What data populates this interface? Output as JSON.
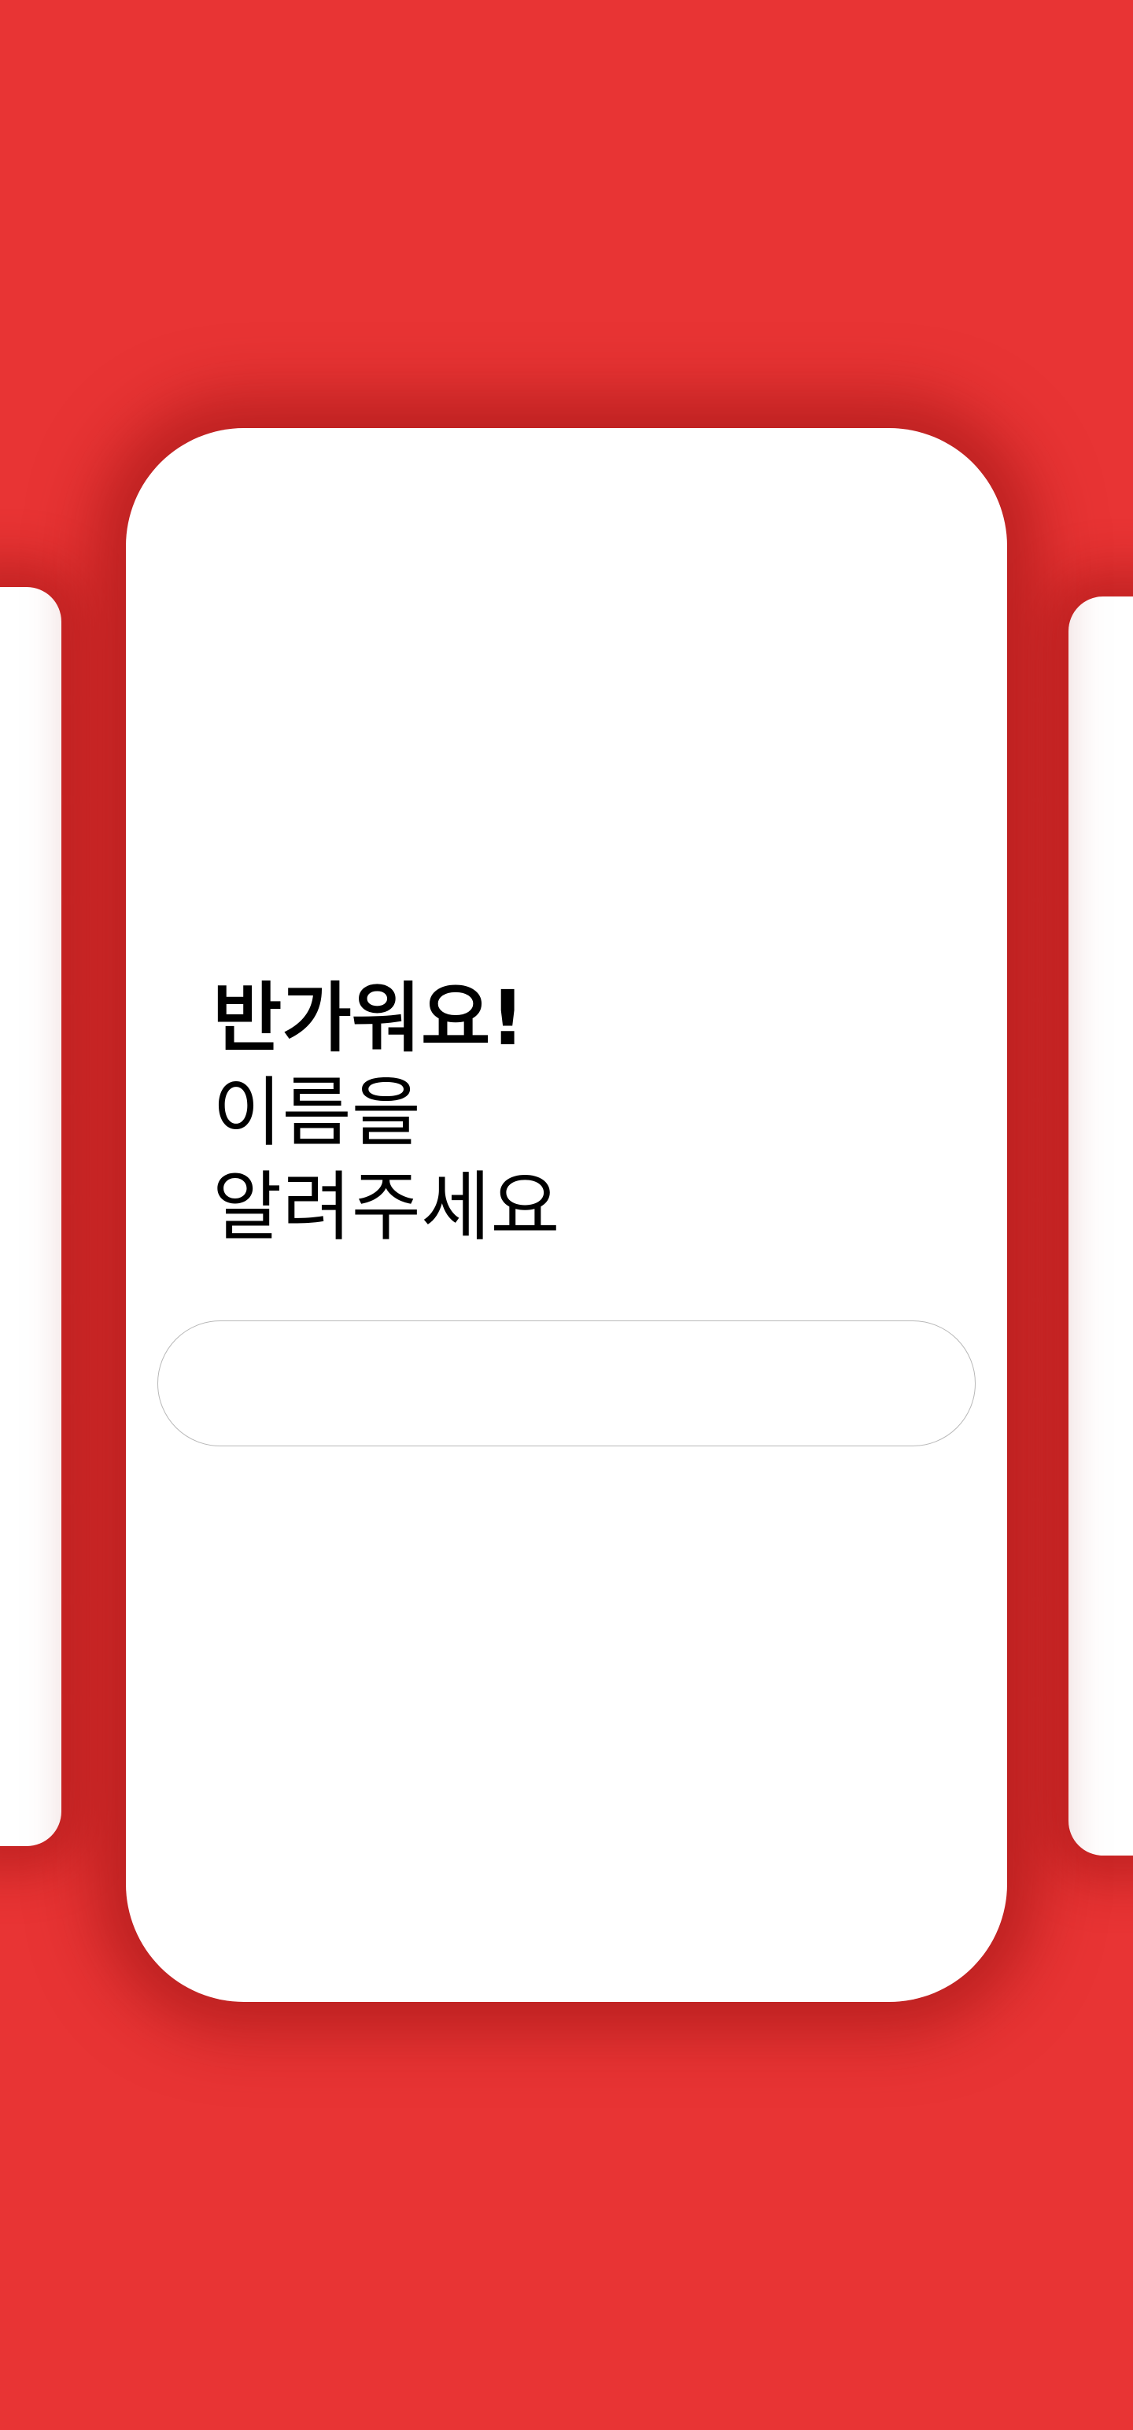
{
  "screen": {
    "background_color": "#e83434",
    "card_color": "#ffffff"
  },
  "greeting": {
    "line1": "반가워요!",
    "line2": "이름을",
    "line3": "알려주세요"
  },
  "name_input": {
    "value": "",
    "placeholder": ""
  }
}
